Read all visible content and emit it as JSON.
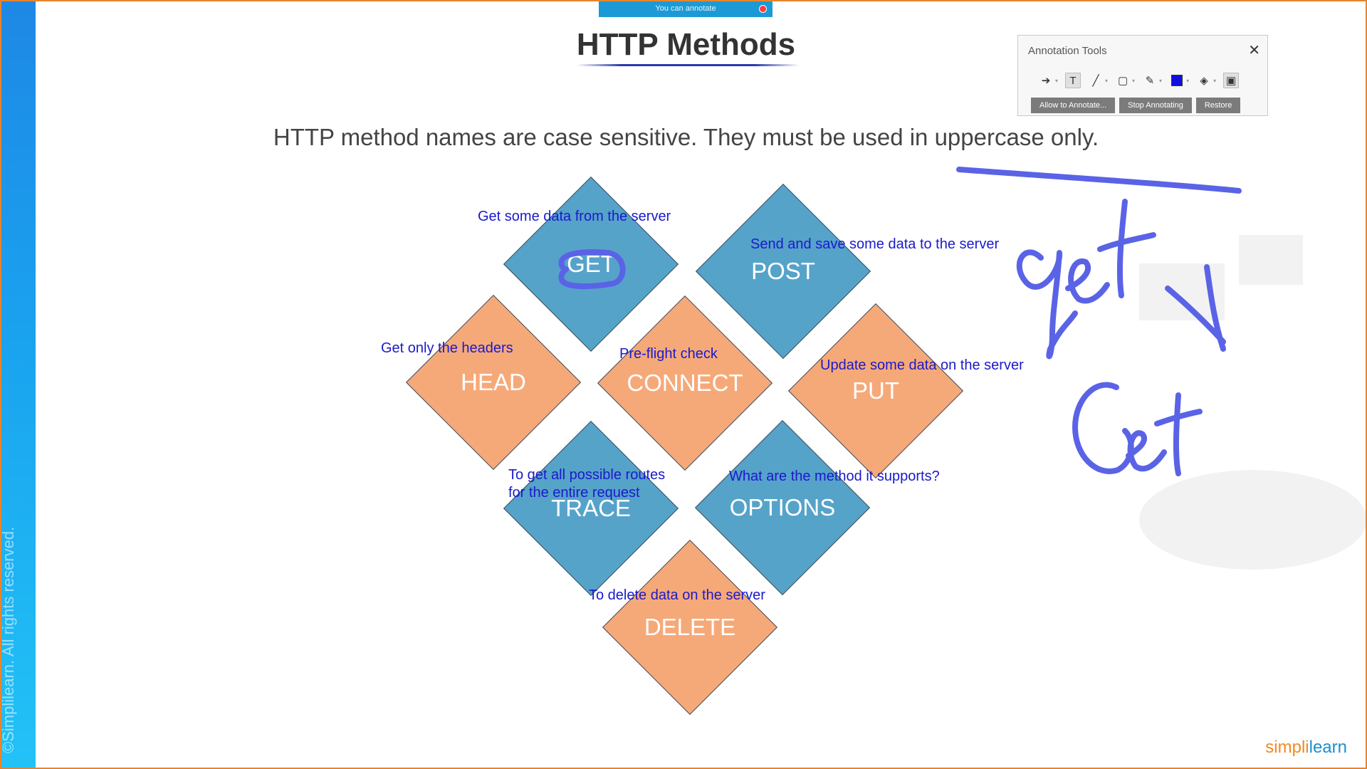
{
  "banner": {
    "text": "You can annotate"
  },
  "slide": {
    "title": "HTTP Methods",
    "subtitle": "HTTP method names are case sensitive. They must be used in uppercase only.",
    "copyright": "©Simplilearn. All rights reserved."
  },
  "methods": [
    {
      "label": "GET",
      "note": "Get some data from the server",
      "color": "#56a3c9"
    },
    {
      "label": "POST",
      "note": "Send and save some data to the server",
      "color": "#56a3c9"
    },
    {
      "label": "HEAD",
      "note": "Get only the headers",
      "color": "#f6a978"
    },
    {
      "label": "CONNECT",
      "note": "Pre-flight check",
      "color": "#f6a978"
    },
    {
      "label": "PUT",
      "note": "Update some data on the server",
      "color": "#f6a978"
    },
    {
      "label": "TRACE",
      "note": "To get all possible routes",
      "note2": "for the entire request",
      "color": "#56a3c9"
    },
    {
      "label": "OPTIONS",
      "note": "What are the method it supports?",
      "color": "#56a3c9"
    },
    {
      "label": "DELETE",
      "note": "To delete data on the server",
      "color": "#f6a978"
    }
  ],
  "annotation_tools": {
    "title": "Annotation Tools",
    "buttons": {
      "allow": "Allow to Annotate...",
      "stop": "Stop Annotating",
      "restore": "Restore"
    }
  },
  "brand": {
    "part1": "simpli",
    "part2": "learn"
  },
  "colors": {
    "ink": "#5a63e6",
    "note_text": "#1a1acc",
    "accent": "#1c9ad6"
  }
}
